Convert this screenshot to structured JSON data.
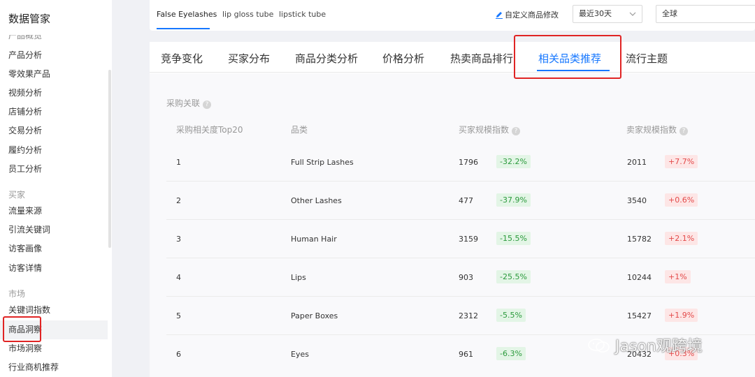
{
  "sidebar": {
    "title": "数据管家",
    "partial_item": "产品概览",
    "items_group1": [
      "产品分析",
      "零效果产品",
      "视频分析",
      "店铺分析",
      "交易分析",
      "履约分析",
      "员工分析"
    ],
    "section_buyer": "买家",
    "items_group2": [
      "流量来源",
      "引流关键词",
      "访客画像",
      "访客详情"
    ],
    "section_market": "市场",
    "items_group3": [
      "关键词指数",
      "商品洞察",
      "市场洞察",
      "行业商机推荐"
    ]
  },
  "topbar": {
    "product_tabs": [
      "False Eyelashes",
      "lip gloss tube",
      "lipstick tube"
    ],
    "custom_link": "自定义商品修改",
    "date_select": "最近30天",
    "region_select": "全球"
  },
  "tabs": [
    "竞争变化",
    "买家分布",
    "商品分类分析",
    "价格分析",
    "热卖商品排行",
    "相关品类推荐",
    "流行主题"
  ],
  "active_tab": "相关品类推荐",
  "section": {
    "title": "采购关联",
    "columns": {
      "rank": "采购相关度Top20",
      "category": "品类",
      "buyer_index": "买家规模指数",
      "seller_index": "卖家规模指数"
    },
    "rows": [
      {
        "rank": "1",
        "category": "Full Strip Lashes",
        "buyer": "1796",
        "buyer_change": "-32.2%",
        "seller": "2011",
        "seller_change": "+7.7%"
      },
      {
        "rank": "2",
        "category": "Other Lashes",
        "buyer": "477",
        "buyer_change": "-37.9%",
        "seller": "3540",
        "seller_change": "+0.6%"
      },
      {
        "rank": "3",
        "category": "Human Hair",
        "buyer": "3159",
        "buyer_change": "-15.5%",
        "seller": "15782",
        "seller_change": "+2.1%"
      },
      {
        "rank": "4",
        "category": "Lips",
        "buyer": "903",
        "buyer_change": "-25.5%",
        "seller": "10244",
        "seller_change": "+1%"
      },
      {
        "rank": "5",
        "category": "Paper Boxes",
        "buyer": "2312",
        "buyer_change": "-5.5%",
        "seller": "15427",
        "seller_change": "+1.9%"
      },
      {
        "rank": "6",
        "category": "Eyes",
        "buyer": "961",
        "buyer_change": "-6.3%",
        "seller": "20432",
        "seller_change": "+0.3%"
      }
    ]
  },
  "watermark": "Jason观跨境",
  "colors": {
    "accent": "#1677ff",
    "highlight": "#e02424",
    "down": "#2b9a3c",
    "up": "#e34a4a"
  }
}
